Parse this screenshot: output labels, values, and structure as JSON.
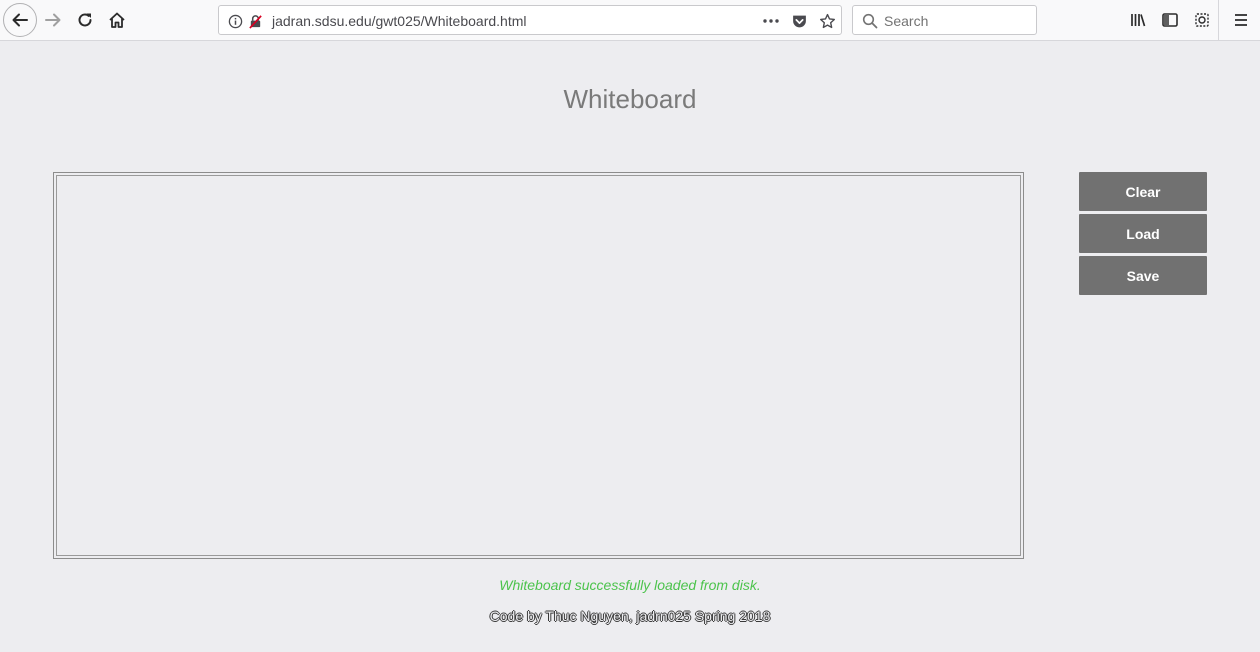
{
  "browser": {
    "url": "jadran.sdsu.edu/gwt025/Whiteboard.html",
    "search_placeholder": "Search",
    "icons": {
      "back": "back-arrow-icon",
      "forward": "forward-arrow-icon",
      "reload": "reload-icon",
      "home": "home-icon",
      "info": "info-icon",
      "insecure": "insecure-lock-icon",
      "more": "ellipsis-icon",
      "pocket": "pocket-icon",
      "bookmark": "star-icon",
      "search": "search-icon",
      "library": "library-icon",
      "sidebar": "sidebar-icon",
      "screenshot": "screenshot-icon",
      "menu": "hamburger-menu-icon"
    }
  },
  "page": {
    "title": "Whiteboard",
    "buttons": {
      "clear": "Clear",
      "load": "Load",
      "save": "Save"
    },
    "status_message": "Whiteboard successfully loaded from disk.",
    "footer": "Code by Thuc Nguyen, jadrn025 Spring 2018"
  },
  "colors": {
    "background": "#ededf0",
    "button": "#717171",
    "status_text": "#4cc34c",
    "title_text": "#7a7a7a"
  }
}
